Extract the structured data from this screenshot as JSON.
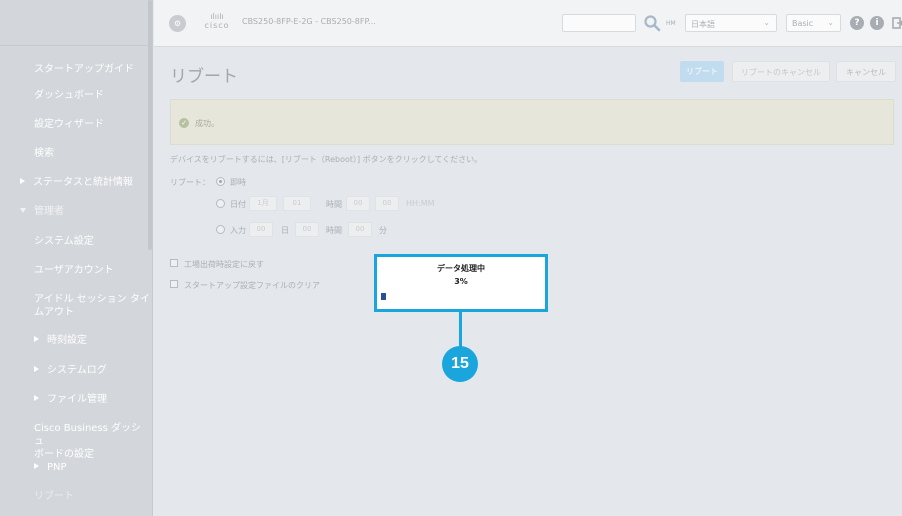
{
  "sidebar": {
    "items": [
      {
        "label": "スタートアップガイド"
      },
      {
        "label": "ダッシュボード"
      },
      {
        "label": "設定ウィザード"
      },
      {
        "label": "検索"
      },
      {
        "label": "ステータスと統計情報"
      },
      {
        "label": "管理者"
      },
      {
        "label": "システム設定"
      },
      {
        "label": "ユーザアカウント"
      },
      {
        "label": "アイドル セッション タイ"
      },
      {
        "label": "ムアウト"
      },
      {
        "label": "時刻設定"
      },
      {
        "label": "システムログ"
      },
      {
        "label": "ファイル管理"
      },
      {
        "label": "Cisco Business ダッシュ"
      },
      {
        "label": "ボードの設定"
      },
      {
        "label": "PNP"
      },
      {
        "label": "リブート"
      }
    ]
  },
  "header": {
    "logo_icon": "device-icon",
    "logo_bars": "ılıılı",
    "logo_word": "cisco",
    "device_name": "CBS250-8FP-E-2G - CBS250-8FP...",
    "search_icon": "search-icon",
    "hm_label": "HM",
    "language": "日本語",
    "mode": "Basic",
    "help_glyph": "?",
    "info_glyph": "i"
  },
  "page": {
    "title": "リブート",
    "buttons": {
      "reboot": "リブート",
      "cancel_reboot": "リブートのキャンセル",
      "cancel": "キャンセル"
    },
    "success_text": "成功。",
    "instruction": "デバイスをリブートするには、[リブート（Reboot）] ボタンをクリックしてください。",
    "reboot_label": "リブート：",
    "options": {
      "immediate": "即時",
      "date": "日付",
      "date_month": "1月",
      "date_day": "01",
      "time_label": "時間",
      "date_hour": "00",
      "date_minute": "00",
      "hhmm": "HH:MM",
      "input": "入力",
      "in_day": "00",
      "day_unit": "日",
      "in_hour": "00",
      "hour_unit": "時間",
      "in_minute": "00",
      "minute_unit": "分"
    },
    "checkbox_factory": "工場出荷時設定に戻す",
    "checkbox_startup": "スタートアップ設定ファイルのクリア"
  },
  "progress": {
    "title": "データ処理中",
    "percent_label": "3%",
    "percent": 3
  },
  "callout": {
    "number": "15"
  },
  "colors": {
    "accent": "#1aa6dd",
    "progress_fill": "#2b4f8f",
    "sidebar_bg": "#d3d6da"
  }
}
